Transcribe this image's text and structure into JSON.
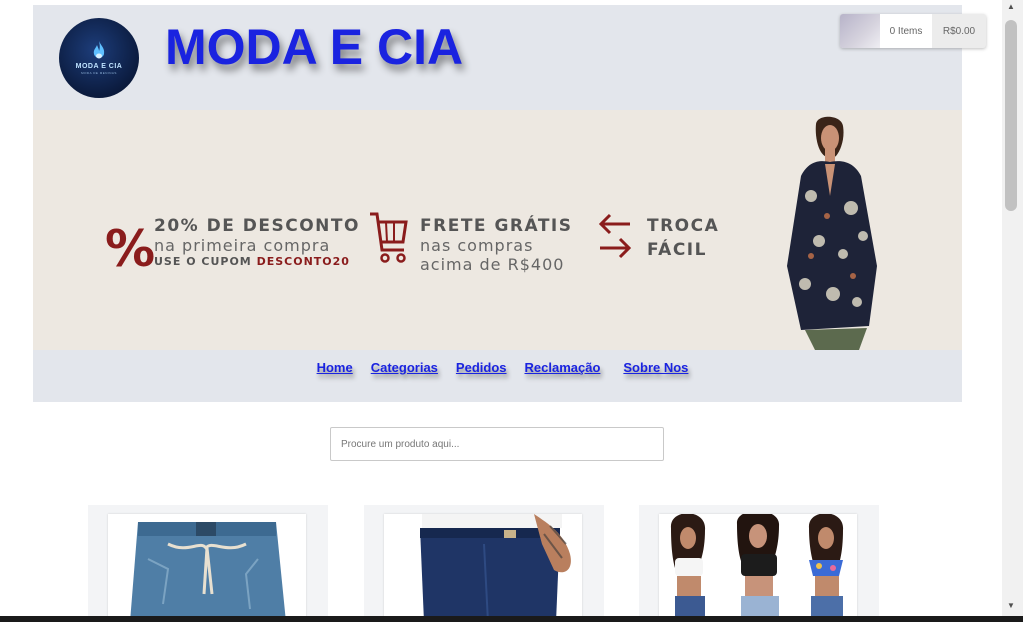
{
  "brand": {
    "title": "MODA E CIA",
    "logo_text": "MODA E CIA",
    "logo_subtext": "MODA DE MENINAS"
  },
  "cart": {
    "items_label": "0 Items",
    "total": "R$0.00"
  },
  "banner": {
    "discount": {
      "line1": "20% DE DESCONTO",
      "line2": "na primeira compra",
      "line3_prefix": "USE O CUPOM",
      "coupon": "DESCONTO20"
    },
    "shipping": {
      "line1": "FRETE GRÁTIS",
      "line2": "nas compras",
      "line3": "acima de R$400"
    },
    "exchange": {
      "line1": "TROCA",
      "line2": "FÁCIL"
    }
  },
  "nav": {
    "items": [
      "Home",
      "Categorias",
      "Pedidos",
      "Reclamação",
      "Sobre Nos"
    ]
  },
  "search": {
    "placeholder": "Procure um produto aqui..."
  },
  "colors": {
    "brand": "#1a23e0",
    "accent": "#8a1c1c",
    "header_bg": "#e3e6ec",
    "banner_bg": "#ede8e1"
  }
}
